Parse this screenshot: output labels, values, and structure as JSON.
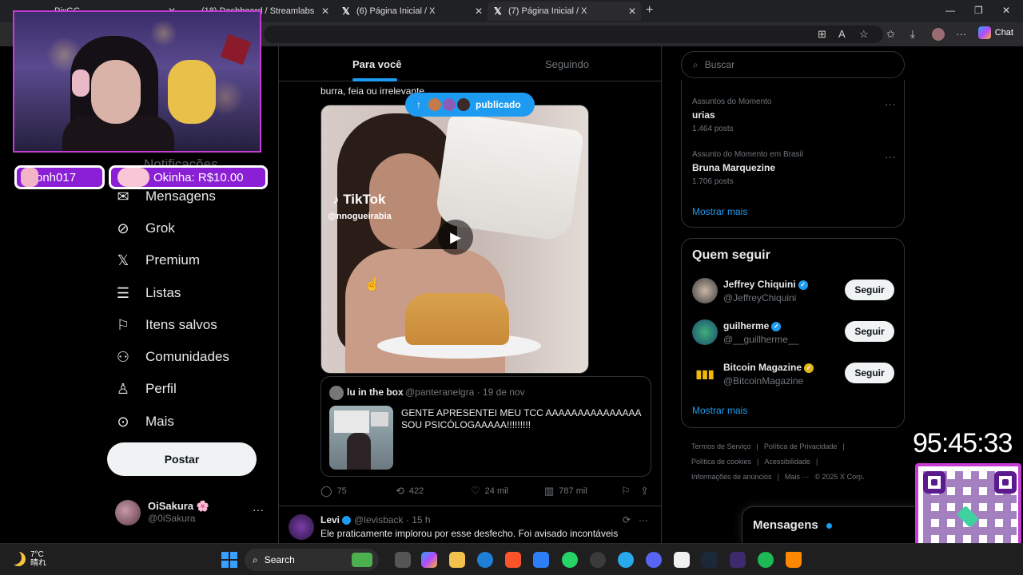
{
  "browser": {
    "tabs": [
      {
        "title": "PixGG"
      },
      {
        "title": "(18) Dashboard / Streamlabs"
      },
      {
        "title": "(6) Página Inicial / X"
      },
      {
        "title": "(7) Página Inicial / X"
      }
    ],
    "chat_label": "Chat"
  },
  "nav": {
    "notifications_ghost": "Notificações",
    "items": [
      {
        "label": "Mensagens",
        "icon": "mail-icon"
      },
      {
        "label": "Grok",
        "icon": "grok-icon"
      },
      {
        "label": "Premium",
        "icon": "x-logo-icon"
      },
      {
        "label": "Listas",
        "icon": "list-icon"
      },
      {
        "label": "Itens salvos",
        "icon": "bookmark-icon"
      },
      {
        "label": "Comunidades",
        "icon": "communities-icon"
      },
      {
        "label": "Perfil",
        "icon": "person-icon"
      },
      {
        "label": "Mais",
        "icon": "more-circle-icon"
      }
    ],
    "post_label": "Postar",
    "profile": {
      "name": "OiSakura 🌸",
      "handle": "@0iSakura"
    }
  },
  "feed": {
    "tab_for_you": "Para você",
    "tab_following": "Seguindo",
    "partial_text": "burra, feia ou irrelevante",
    "published_pill": "publicado",
    "video": {
      "watermark": "TikTok",
      "handle": "@nnogueirabia"
    },
    "quote": {
      "name": "lu in the box",
      "handle": "@panteranelgra",
      "date": "19 de nov",
      "text": "GENTE APRESENTEI MEU TCC AAAAAAAAAAAAAAA SOU PSICÓLOGAAAAA!!!!!!!!!"
    },
    "actions": {
      "replies": "75",
      "reposts": "422",
      "likes": "24 mil",
      "views": "787 mil"
    },
    "next_tweet": {
      "name": "Levi",
      "meta": "@levisback · 15 h",
      "text": "Ele praticamente implorou por esse desfecho. Foi avisado incontáveis"
    }
  },
  "sidebar": {
    "search_placeholder": "Buscar",
    "trends": [
      {
        "context": "Assuntos do Momento",
        "title": "urias",
        "count": "1.464 posts"
      },
      {
        "context": "Assunto do Momento em Brasil",
        "title": "Bruna Marquezine",
        "count": "1.706 posts"
      }
    ],
    "show_more": "Mostrar mais",
    "who_to_follow_title": "Quem seguir",
    "follow": [
      {
        "name": "Jeffrey Chiquini",
        "handle": "@JeffreyChiquini",
        "badge": "blue"
      },
      {
        "name": "guilherme",
        "handle": "@__guillherme__",
        "badge": "blue"
      },
      {
        "name": "Bitcoin Magazine",
        "handle": "@BitcoinMagazine",
        "badge": "gold"
      }
    ],
    "follow_button": "Seguir",
    "footer": [
      "Termos de Serviço",
      "|",
      "Política de Privacidade",
      "|",
      "Política de cookies",
      "|",
      "Acessibilidade",
      "|",
      "Informações de anúncios",
      "|",
      "Mais ···",
      "© 2025 X Corp."
    ],
    "messages_drawer": "Mensagens"
  },
  "stream": {
    "donation_left": "onh017",
    "donation_right": "Okinha: R$10.00",
    "timer": "95:45:33"
  },
  "taskbar": {
    "weather_temp": "7°C",
    "weather_desc": "晴れ",
    "search_label": "Search"
  },
  "colors": {
    "accent": "#1d9bf0",
    "stream_purple": "#8b1fd6",
    "frame": "#c63bd4"
  }
}
